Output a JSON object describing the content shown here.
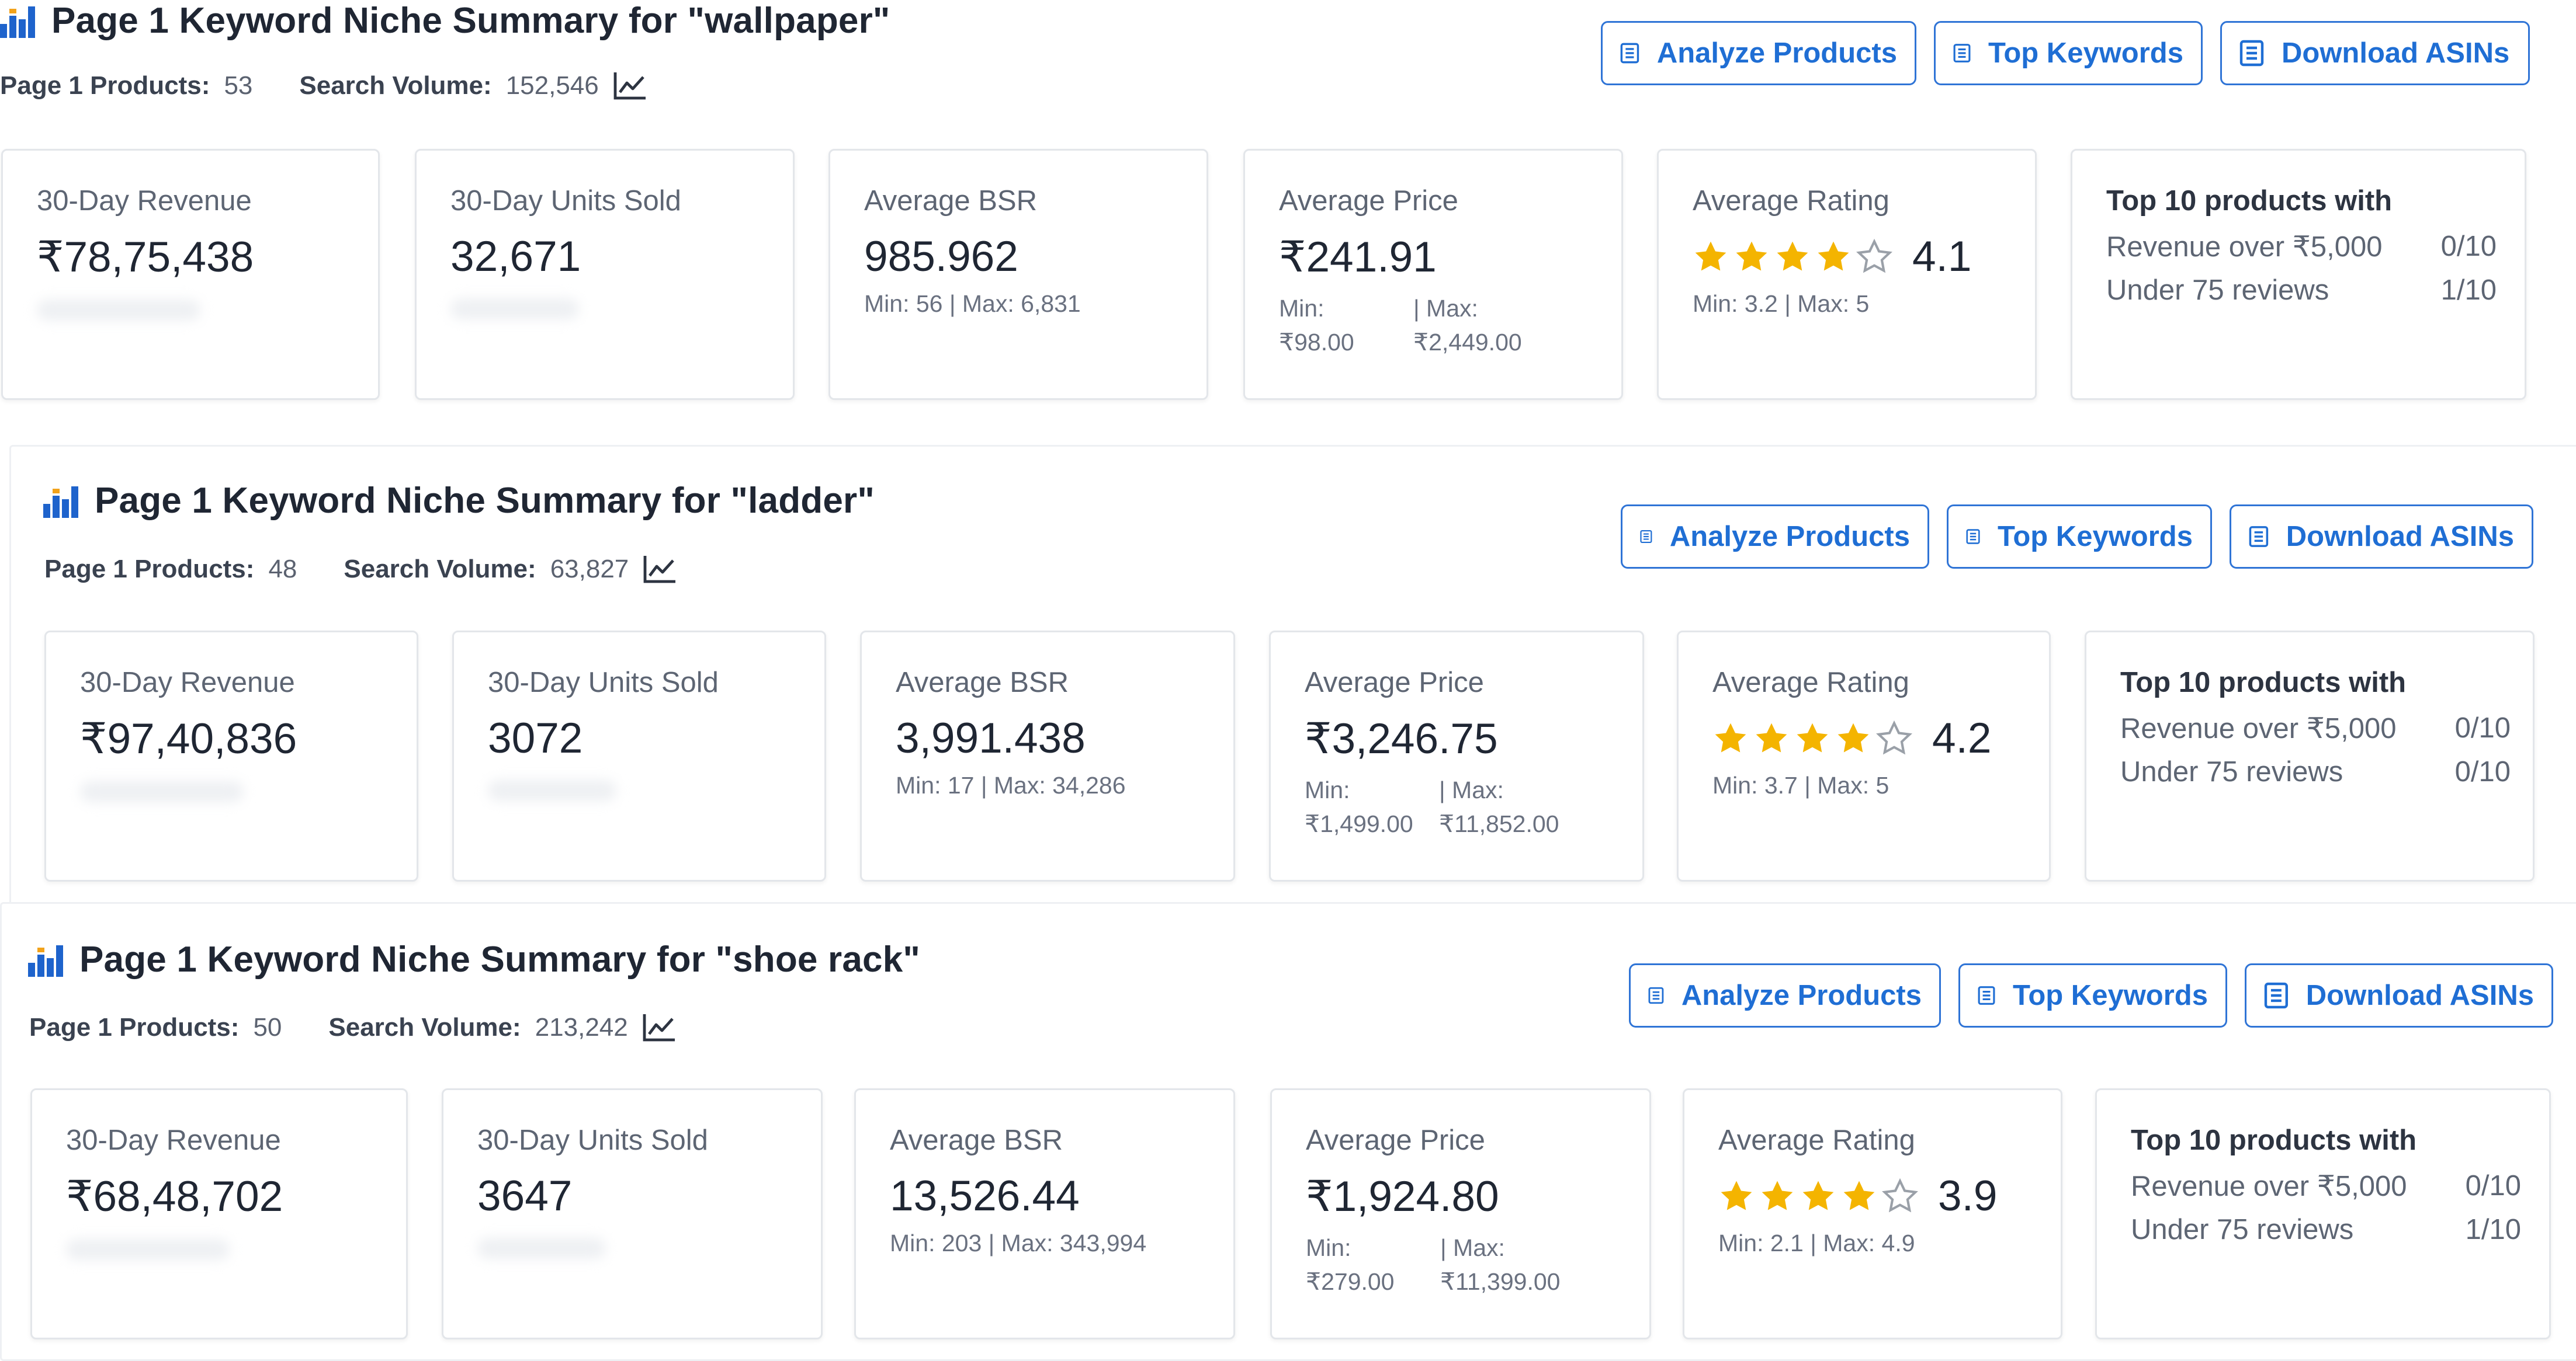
{
  "accent": "#1f6ed4",
  "sections": [
    {
      "title": "Page 1 Keyword Niche Summary for \"wallpaper\"",
      "products_label": "Page 1 Products:",
      "products_value": "53",
      "volume_label": "Search Volume:",
      "volume_value": "152,546",
      "buttons": [
        "Analyze Products",
        "Top Keywords",
        "Download ASINs"
      ],
      "revenue_label": "30-Day Revenue",
      "revenue_value": "₹78,75,438",
      "units_label": "30-Day Units Sold",
      "units_value": "32,671",
      "bsr_label": "Average BSR",
      "bsr_value": "985.962",
      "bsr_range": "Min: 56 | Max: 6,831",
      "price_label": "Average Price",
      "price_value": "₹241.91",
      "price_min_label": "Min:",
      "price_max_label": "| Max:",
      "price_min": "₹98.00",
      "price_max": "₹2,449.00",
      "rating_label": "Average Rating",
      "rating_value": "4.1",
      "rating_stars": 4,
      "rating_range": "Min: 3.2 | Max: 5",
      "top_title": "Top 10 products with",
      "top_revenue_label": "Revenue over ₹5,000",
      "top_revenue_value": "0/10",
      "top_reviews_label": "Under 75 reviews",
      "top_reviews_value": "1/10"
    },
    {
      "title": "Page 1 Keyword Niche Summary for \"ladder\"",
      "products_label": "Page 1 Products:",
      "products_value": "48",
      "volume_label": "Search Volume:",
      "volume_value": "63,827",
      "buttons": [
        "Analyze Products",
        "Top Keywords",
        "Download ASINs"
      ],
      "revenue_label": "30-Day Revenue",
      "revenue_value": "₹97,40,836",
      "units_label": "30-Day Units Sold",
      "units_value": "3072",
      "bsr_label": "Average BSR",
      "bsr_value": "3,991.438",
      "bsr_range": "Min: 17 | Max: 34,286",
      "price_label": "Average Price",
      "price_value": "₹3,246.75",
      "price_min_label": "Min:",
      "price_max_label": "| Max:",
      "price_min": "₹1,499.00",
      "price_max": "₹11,852.00",
      "rating_label": "Average Rating",
      "rating_value": "4.2",
      "rating_stars": 4,
      "rating_range": "Min: 3.7 | Max: 5",
      "top_title": "Top 10 products with",
      "top_revenue_label": "Revenue over ₹5,000",
      "top_revenue_value": "0/10",
      "top_reviews_label": "Under 75 reviews",
      "top_reviews_value": "0/10"
    },
    {
      "title": "Page 1 Keyword Niche Summary for \"shoe rack\"",
      "products_label": "Page 1 Products:",
      "products_value": "50",
      "volume_label": "Search Volume:",
      "volume_value": "213,242",
      "buttons": [
        "Analyze Products",
        "Top Keywords",
        "Download ASINs"
      ],
      "revenue_label": "30-Day Revenue",
      "revenue_value": "₹68,48,702",
      "units_label": "30-Day Units Sold",
      "units_value": "3647",
      "bsr_label": "Average BSR",
      "bsr_value": "13,526.44",
      "bsr_range": "Min: 203 | Max: 343,994",
      "price_label": "Average Price",
      "price_value": "₹1,924.80",
      "price_min_label": "Min:",
      "price_max_label": "| Max:",
      "price_min": "₹279.00",
      "price_max": "₹11,399.00",
      "rating_label": "Average Rating",
      "rating_value": "3.9",
      "rating_stars": 4,
      "rating_range": "Min: 2.1 | Max: 4.9",
      "top_title": "Top 10 products with",
      "top_revenue_label": "Revenue over ₹5,000",
      "top_revenue_value": "0/10",
      "top_reviews_label": "Under 75 reviews",
      "top_reviews_value": "1/10"
    }
  ]
}
